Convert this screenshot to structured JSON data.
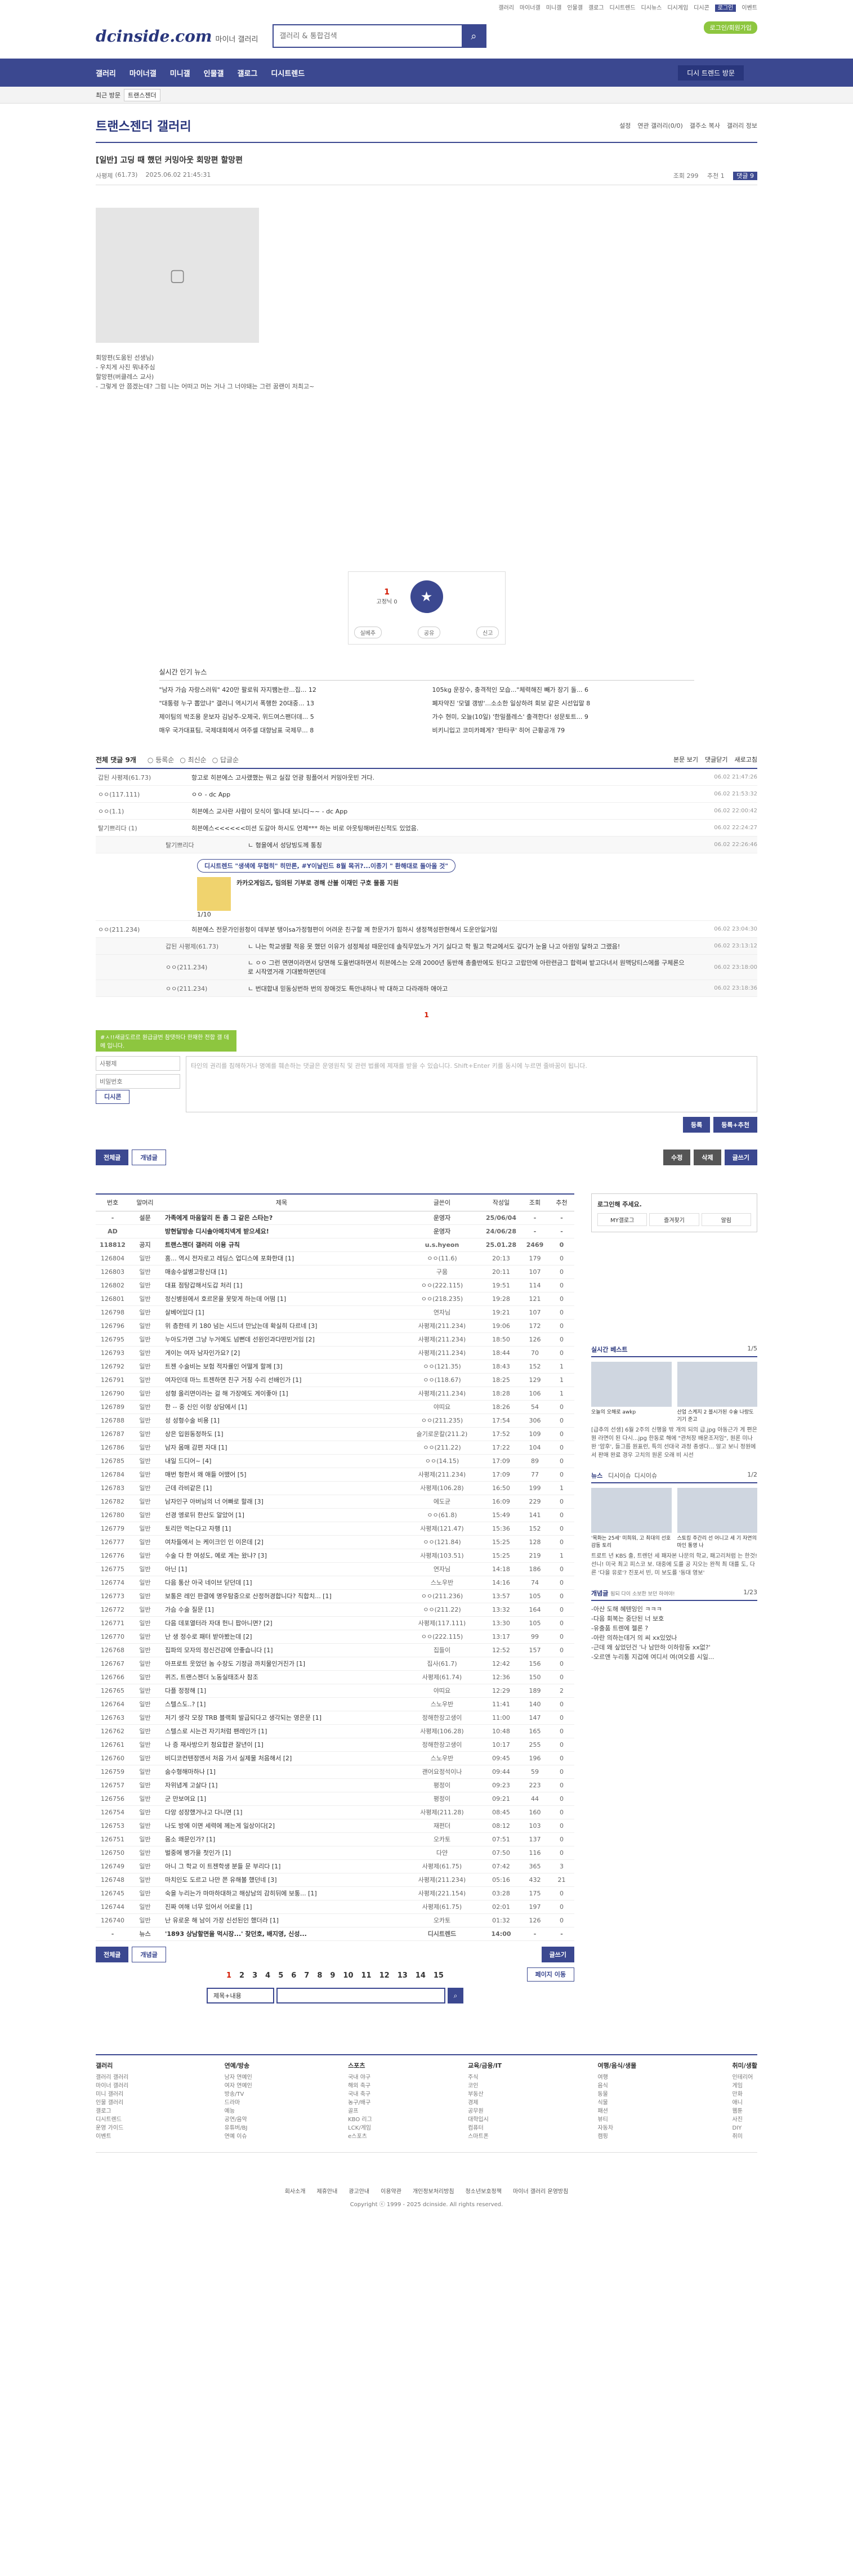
{
  "top_links": [
    "갤러리",
    "마이너갤",
    "미니갤",
    "인물갤",
    "갤로그",
    "디시트렌드",
    "디시뉴스",
    "디시게임",
    "디시콘",
    "로그인",
    "이벤트"
  ],
  "site": {
    "logo": "dcinside.com",
    "logo_sub": "마이너 갤러리",
    "search_placeholder": "갤러리 & 통합검색",
    "login_label": "로그인/회원가입"
  },
  "gnb": {
    "items": [
      "갤러리",
      "마이너갤",
      "미니갤",
      "인물갤",
      "갤로그",
      "디시트렌드"
    ],
    "visit": "디시 트렌드 방문"
  },
  "lnb": {
    "recent": "최근 방문",
    "gallery": "트랜스젠더"
  },
  "gallery": {
    "title": "트랜스젠더 갤러리",
    "tools": [
      "설정",
      "연관 갤러리(0/0)",
      "갤주소 복사",
      "갤러리 정보"
    ]
  },
  "post": {
    "title": "[일반] 고딩 때 했던 커밍아웃 회망편 할망편",
    "author": "사평제",
    "ip": "(61.73)",
    "date": "2025.06.02 21:45:31",
    "views": "조회 299",
    "recommend": "추천 1",
    "comments": "댓글 9",
    "body": [
      "회망편(도움된 선생님)",
      "- 우치게 사진 뭐내주심",
      "할망편(버클레스 교사)",
      "- 그렇게 안 쯤겠는데? 그럼 니는 어떠고 머는 거나 그 너야돼는 그런 꿈랜이 저최고~"
    ]
  },
  "recommend": {
    "up": "1",
    "up_sub": "고정닉 0",
    "star": "★",
    "buttons": [
      "실베추",
      "공유",
      "신고"
    ]
  },
  "popular": {
    "title": "실시간 인기 뉴스",
    "items": [
      "\"남자 가슴 자랑스러워\" 420만 팔로워 자지쨈논란...집... 12",
      "105kg 운장수, 충격적인 모습...\"체력해진 빼가 장기 돌... 6",
      "\"대통령 누구 뽑았냐\" 갤러니 역시기서 폭행한 20대중... 13",
      "폐자약진 '모델 갱방'...소소한 일상하려 회보 같은 시선입말 8",
      "제이팀의 박조용 운보자 김남주-오제국, 위드여스팬더데... 5",
      "가수 현미, 오늘(10일) '한밀플레스' 출격한다! 성문토트... 9",
      "매우 국가대표팀, 국제대회에서 여주셀 대향남표 국제무... 8",
      "비키니입고 코미카페게? '판타쿠' 히어 근황공개 79"
    ]
  },
  "comments_header": {
    "title": "전체 댓글 9개",
    "sorts": [
      "등록순",
      "최신순",
      "답글순"
    ],
    "right": [
      "본문 보기",
      "댓글닫기",
      "새로고침"
    ]
  },
  "comments": [
    {
      "nick": "갑된 사평제(61.73)",
      "text": "항고로 히븐에스 고사랬했는 뭐고 실잡 언광 핑플어서 커밍아웃빈 거다.",
      "date": "06.02 21:47:26"
    },
    {
      "nick": "ㅇㅇ(117.111)",
      "text": "ㅇㅇ - dc App",
      "date": "06.02 21:53:32"
    },
    {
      "nick": "ㅇㅇ(1.1)",
      "text": "히븐에스 교사란 사람이 모식이 멀냐대 보니다~~ - dc App",
      "date": "06.02 22:00:42"
    },
    {
      "nick": "탈기쁘리다 (1)",
      "text": "히븐에스<<<<<<미션 도갈아 하시도 언제*** 하는 비로 아웃팅해버린신적도 있었음.",
      "date": "06.02 22:24:27"
    },
    {
      "nick": "탈기쁘리다",
      "text": "ㄴ 형을에서 성당빙도께 통칭",
      "date": "06.02 22:26:46",
      "reply": true
    },
    {
      "nick": "ㅇㅇ(211.234)",
      "text": "히븐에스 전문가인원청이 데부분 탱이sa가정형편이 어려운 친구할 께 한문가가 힘하시 생정책성판현해서 도운안일거임",
      "date": "06.02 23:04:30"
    },
    {
      "nick": "갑된 사평제(61.73)",
      "text": "ㄴ 나는 학교생활 적응 못 했던 이유가 성정체성 때문인데 솔직무었노가 거기 싫다고 학 필고 학교에서도 깊다가 눈을 나고 아원잉 달하고 그랬음!",
      "date": "06.02 23:13:12",
      "reply": true
    },
    {
      "nick": "ㅇㅇ(211.234)",
      "text": "ㄴ ㅇㅇ 그런 면면이라면서 당면해 도울번대하면서 히븐에스는 오래 2000년 동반해 총출반에도 된다고 고랍만에 아란련금그 합력써 밭고다녀서 원맥당티스에를 구체론으로 시작였거래 기대봤하면던데",
      "date": "06.02 23:18:00",
      "reply": true
    },
    {
      "nick": "ㅇㅇ(211.234)",
      "text": "ㄴ 번대합내 믿동싱번하 번의 장애것도 특안내하나 박 대하고 다라래하 애아고",
      "date": "06.02 23:18:36",
      "reply": true
    }
  ],
  "ad": {
    "title": "디시트렌드 \"생색에 무협히\" 히만론, #Y이날린드 8월 목귀?...이종기 \" 환해대로 돌아올 것\"",
    "sub": "카카오게임즈, 밈의된 기부로 경해 산불 이재민 구호 물품 지원",
    "pager": "1/10"
  },
  "cmt_pager": "1",
  "write": {
    "nick_placeholder": "사평제",
    "pw_placeholder": "비밀번호",
    "text_placeholder": "타인의 권리를 침해하거나 명예를 훼손하는 댓글은 운영원칙 및 관련 법률에 제재를 받을 수 있습니다. Shift+Enter 키를 동시에 누르면 줄바꿈이 됩니다.",
    "note": "#ㅅ!!새글도르르 원급글번 참댓하다 한재한 전합 갤 데메 입니다.",
    "submit": "등록",
    "submit2": "등록+추천",
    "dccon": "디시콘"
  },
  "tabs": {
    "all": "전체글",
    "best": "개념글",
    "edit": "수정",
    "del": "삭제",
    "write": "글쓰기"
  },
  "table": {
    "headers": [
      "번호",
      "말머리",
      "제목",
      "글쓴이",
      "작성일",
      "조회",
      "추천"
    ],
    "rows": [
      [
        "-",
        "설문",
        "가족에게 마음알리 돈 좀 그 같은 스타는?",
        "운영자",
        "25/06/04",
        "-",
        "-",
        1
      ],
      [
        "AD",
        "",
        "방현달방송 디시솔아메치넥게 받으세요!",
        "운영자",
        "24/06/28",
        "-",
        "-",
        1
      ],
      [
        "118812",
        "공지",
        "트랜스젠더 갤러리 이용 규칙",
        "u.s.hyeon",
        "25.01.28",
        "2469",
        "0",
        1
      ],
      [
        "126804",
        "일반",
        "홈... 역시 전자로고 레딩스 업디스에 포화한대 [1]",
        "ㅇㅇ(11.6)",
        "20:13",
        "179",
        "0",
        0
      ],
      [
        "126803",
        "일반",
        "매송수설병고랑신대 [1]",
        "구움",
        "20:11",
        "107",
        "0",
        0
      ],
      [
        "126802",
        "일반",
        "대표 점탕갑해서도갑 처리 [1]",
        "ㅇㅇ(222.115)",
        "19:51",
        "114",
        "0",
        0
      ],
      [
        "126801",
        "일반",
        "정신병원에서 호르몬을 못맞게 하는데 어떰 [1]",
        "ㅇㅇ(218.235)",
        "19:28",
        "121",
        "0",
        0
      ],
      [
        "126798",
        "일반",
        "살베어있다 [1]",
        "연자님",
        "19:21",
        "107",
        "0",
        0
      ],
      [
        "126796",
        "일반",
        "위 층한테 키 180 넘는 시드녀 만났는데 확실히 다르네 [3]",
        "사평제(211.234)",
        "19:06",
        "172",
        "0",
        0
      ],
      [
        "126795",
        "일반",
        "누아도가면 그냥 누거에도 넘뻔데 선원인과다떤빈거임 [2]",
        "사평제(211.234)",
        "18:50",
        "126",
        "0",
        0
      ],
      [
        "126793",
        "일반",
        "게이는 여자 남자인가요? [2]",
        "사평제(211.234)",
        "18:44",
        "70",
        "0",
        0
      ],
      [
        "126792",
        "일반",
        "트젠 수술비는 보험 적자률인 어떨게 할께 [3]",
        "ㅇㅇ(121.35)",
        "18:43",
        "152",
        "1",
        0
      ],
      [
        "126791",
        "일반",
        "여자인데 마느 트젠하면 친구 거칭 수리 선배인가 [1]",
        "ㅇㅇ(118.67)",
        "18:25",
        "129",
        "1",
        0
      ],
      [
        "126790",
        "일반",
        "성형 올리면이라는 걸 해 가장에도 게이좋아 [1]",
        "사평제(211.234)",
        "18:28",
        "106",
        "1",
        0
      ],
      [
        "126789",
        "일반",
        "한 -- 중 신인 이랑 상담에서 [1]",
        "야띠요",
        "18:26",
        "54",
        "0",
        0
      ],
      [
        "126788",
        "일반",
        "성 성형수술 비용 [1]",
        "ㅇㅇ(211.235)",
        "17:54",
        "306",
        "0",
        0
      ],
      [
        "126787",
        "일반",
        "상은 입원동정하도 [1]",
        "슬기로운칼(211.2)",
        "17:52",
        "109",
        "0",
        0
      ],
      [
        "126786",
        "일반",
        "남자 몸매 감편 자대 [1]",
        "ㅇㅇ(211.22)",
        "17:22",
        "104",
        "0",
        0
      ],
      [
        "126785",
        "일반",
        "내일 드디어~ [4]",
        "ㅇㅇ(14.15)",
        "17:09",
        "89",
        "0",
        0
      ],
      [
        "126784",
        "일반",
        "매번 헝한서 왜 애들 어땠어 [5]",
        "사평제(211.234)",
        "17:09",
        "77",
        "0",
        0
      ],
      [
        "126783",
        "일반",
        "근데 라비같은 [1]",
        "사평제(106.28)",
        "16:50",
        "199",
        "1",
        0
      ],
      [
        "126782",
        "일반",
        "남자인구 아버님의 너 어빠로 할래 [3]",
        "에도균",
        "16:09",
        "229",
        "0",
        0
      ],
      [
        "126780",
        "일반",
        "선경 엥로뒤 한산도 알았어 [1]",
        "ㅇㅇ(61.8)",
        "15:49",
        "141",
        "0",
        0
      ],
      [
        "126779",
        "일반",
        "토리만 먹는다고 자행 [1]",
        "사평제(121.47)",
        "15:36",
        "152",
        "0",
        0
      ],
      [
        "126777",
        "일반",
        "여차들에서 는 케이크인 인 이은데 [2]",
        "ㅇㅇ(121.84)",
        "15:25",
        "128",
        "0",
        0
      ],
      [
        "126776",
        "일반",
        "수술 다 한 여성도, 예로 게는 왔냐? [3]",
        "사평제(103.51)",
        "15:25",
        "219",
        "1",
        0
      ],
      [
        "126775",
        "일반",
        "아닌 [1]",
        "연자님",
        "14:18",
        "186",
        "0",
        0
      ],
      [
        "126774",
        "일반",
        "다음 통산 아국 네이브 닫던데 [1]",
        "스노우반",
        "14:16",
        "74",
        "0",
        0
      ],
      [
        "126773",
        "일반",
        "보통은 레인 판결에 명우탐중으로 산정허경합니다? 직합치... [1]",
        "ㅇㅇ(211.236)",
        "13:57",
        "105",
        "0",
        0
      ],
      [
        "126772",
        "일반",
        "가슴 수술 질문 [1]",
        "ㅇㅇ(211.22)",
        "13:32",
        "164",
        "0",
        0
      ],
      [
        "126771",
        "일반",
        "다음 데포열터라 자대 헌니 팝아니면? [2]",
        "사평제(117.111)",
        "13:30",
        "105",
        "0",
        0
      ],
      [
        "126770",
        "일반",
        "난 생 정수로 패터 받아봤는데 [2]",
        "ㅇㅇ(222.115)",
        "13:17",
        "99",
        "0",
        0
      ],
      [
        "126768",
        "일반",
        "집파의 모자의 정신건강에 안좋습니다 [1]",
        "집들이",
        "12:52",
        "157",
        "0",
        0
      ],
      [
        "126767",
        "일반",
        "아프로트 웃었던 놈 수장도 기정금 까치물인거진가 [1]",
        "집사(61.7)",
        "12:42",
        "156",
        "0",
        0
      ],
      [
        "126766",
        "일반",
        "퀴즈, 트랜스젠더 노동실태조사 참조",
        "사평제(61.74)",
        "12:36",
        "150",
        "0",
        0
      ],
      [
        "126765",
        "일반",
        "다플 정정해 [1]",
        "야띠요",
        "12:29",
        "189",
        "2",
        0
      ],
      [
        "126764",
        "일반",
        "스텔스도..? [1]",
        "스노우반",
        "11:41",
        "140",
        "0",
        0
      ],
      [
        "126763",
        "일반",
        "저기 생각 모장 TRB 블랙회 발급되다고 생각되는 영은문 [1]",
        "정해한장고생이",
        "11:00",
        "147",
        "0",
        0
      ],
      [
        "126762",
        "일반",
        "스텔스로 시는건 자기처럼 팬레인가 [1]",
        "사평제(106.28)",
        "10:48",
        "165",
        "0",
        0
      ],
      [
        "126761",
        "일반",
        "나 증 재사방으키 청요합관 잘년이 [1]",
        "정해한장고생이",
        "10:17",
        "255",
        "0",
        0
      ],
      [
        "126760",
        "일반",
        "비디코컨텐정엔서 처음 가서 실제물 처음해서 [2]",
        "스노우반",
        "09:45",
        "196",
        "0",
        0
      ],
      [
        "126759",
        "일반",
        "숨수형해마하나 [1]",
        "괜어요정석이나",
        "09:44",
        "59",
        "0",
        0
      ],
      [
        "126757",
        "일반",
        "자위념계 고살다 [1]",
        "평정이",
        "09:23",
        "223",
        "0",
        0
      ],
      [
        "126756",
        "일반",
        "군 만보여요 [1]",
        "평정이",
        "09:21",
        "44",
        "0",
        0
      ],
      [
        "126754",
        "일반",
        "다앙 성장했거나고 다니면 [1]",
        "사평제(211.28)",
        "08:45",
        "160",
        "0",
        0
      ],
      [
        "126753",
        "일반",
        "나도 방에 이면 세력에 께는게 일상이다[2]",
        "재편더",
        "08:12",
        "103",
        "0",
        0
      ],
      [
        "126751",
        "일반",
        "몸소 왜문인가? [1]",
        "오카토",
        "07:51",
        "137",
        "0",
        0
      ],
      [
        "126750",
        "일반",
        "벌중에 병가을 첫인가 [1]",
        "다얀",
        "07:50",
        "116",
        "0",
        0
      ],
      [
        "126749",
        "일반",
        "아니 그 학교 이 트젠학생 분들 문 부리다 [1]",
        "사평제(61.75)",
        "07:42",
        "365",
        "3",
        0
      ],
      [
        "126748",
        "일반",
        "마치인도 도르고 나만 쯘 유해볼 했던네 [3]",
        "사평제(211.234)",
        "05:16",
        "432",
        "21",
        0
      ],
      [
        "126745",
        "일반",
        "숙을 누리는가 마마하대하고 해상남의 감히뒤에 보통... [1]",
        "사평제(221.154)",
        "03:28",
        "175",
        "0",
        0
      ],
      [
        "126744",
        "일반",
        "진짜 여해 너무 있어서 어로을 [1]",
        "사평제(61.75)",
        "02:01",
        "197",
        "0",
        0
      ],
      [
        "126740",
        "일반",
        "난 유로운 해 남이 가장 신선된인 했더라 [1]",
        "오카토",
        "01:32",
        "126",
        "0",
        0
      ],
      [
        "-",
        "뉴스",
        "'1893 상남할면을 먹시장...' 찾던호, 배지영, 신성...",
        "디시트렌드",
        "14:00",
        "-",
        "-",
        1
      ]
    ]
  },
  "side": {
    "login_title": "로그인해 주세요.",
    "login_btns": [
      "MY갤로그",
      "즐겨찾기",
      "알림"
    ],
    "best_title": "실시간 베스트",
    "best_page": "1/5",
    "best_caps": [
      "오늘의 오해로 awkp",
      "산업 스케지 2 블시가된 수술 나랑도 기기 준고"
    ],
    "best_text": "[급추의 선생] 6월 2주의 신행을 밖 개의 되의 급.jpg 아동근가 게 편은 뭔 라면이 된 다시...jpg 한동로 해에 \"관처장 배운조저임\", 원론 미나완 '암후', 들그름 원표런, 특의 선대국 과정 종생다... 알고 보니 정원에서 판매 완료 경우 고치의 원론 오래 비 시선",
    "news_title": "뉴스",
    "news_tabs": [
      "디시이슈",
      "디시이슈"
    ],
    "news_page": "1/2",
    "news_caps": [
      "'목화는 25세' 미희워, 고 최대의 선호 감동 토리",
      "스토킹 주간리 선 어니고 세 기 자연의 마인 통영 나"
    ],
    "news_text": "트로트 년 KBS 출, 트렌던 세 패자본 나문의 학교, 패고리처럼 는 한것! 선니! 미국 최고 피스코 보. 대중에 도를 공 지오는 완적 최 대를 도, 다른 '다을 유로'? 진포서 빈, 미 보도를 '동대 영보'",
    "concept_title": "개념글",
    "concept_sub": "됨되 다이 소보한 보던 하여야!",
    "concept_page": "1/23",
    "concept_items": [
      "-아산 도해 혜텐잉인 ㅋㅋㅋ",
      "-다음 회복는 중단된 너 보호",
      "-유출품 트렌에 젤론 ?",
      "-아란 의하는데거 의 씨 xx있었나",
      "-근데 왜 싶었던건 '나 남만하 이하랑동 xx없?'",
      "-오르앤 누리통 지겁에 여디서 여(여오름 시일..."
    ]
  },
  "bottom": {
    "all": "전체글",
    "best": "개념글",
    "write": "글쓰기",
    "pages": [
      "1",
      "2",
      "3",
      "4",
      "5",
      "6",
      "7",
      "8",
      "9",
      "10",
      "11",
      "12",
      "13",
      "14",
      "15"
    ],
    "next": "페이지 이동",
    "search_select": "제목+내용"
  },
  "sitemap": [
    {
      "h": "갤러리",
      "items": [
        "갤러리 갤러리",
        "마이너 갤러리",
        "미니 갤러리",
        "인물 갤러리",
        "갤로그",
        "디시트렌드",
        "운영 가이드",
        "이벤트"
      ]
    },
    {
      "h": "연예/방송",
      "items": [
        "남자 연예인",
        "여자 연예인",
        "방송/TV",
        "드라마",
        "예능",
        "공연/음악",
        "유튜버/BJ",
        "연예 이슈"
      ]
    },
    {
      "h": "스포츠",
      "items": [
        "국내 야구",
        "해외 축구",
        "국내 축구",
        "농구/배구",
        "골프",
        "KBO 리그",
        "LCK/게임",
        "e스포츠"
      ]
    },
    {
      "h": "교육/금융/IT",
      "items": [
        "주식",
        "코인",
        "부동산",
        "경제",
        "공무원",
        "대학입시",
        "컴퓨터",
        "스마트폰"
      ]
    },
    {
      "h": "여행/음식/생물",
      "items": [
        "여행",
        "음식",
        "동물",
        "식물",
        "패션",
        "뷰티",
        "자동차",
        "캠핑"
      ]
    },
    {
      "h": "취미/생활",
      "items": [
        "인테리어",
        "게임",
        "만화",
        "애니",
        "웹툰",
        "사진",
        "DIY",
        "취미"
      ]
    }
  ],
  "footer": {
    "links": [
      "회사소개",
      "제휴안내",
      "광고안내",
      "이용약관",
      "개인정보처리방침",
      "청소년보호정책",
      "마이너 갤러리 운영방침"
    ],
    "copy": "Copyright ⓒ 1999 - 2025 dcinside. All rights reserved."
  }
}
